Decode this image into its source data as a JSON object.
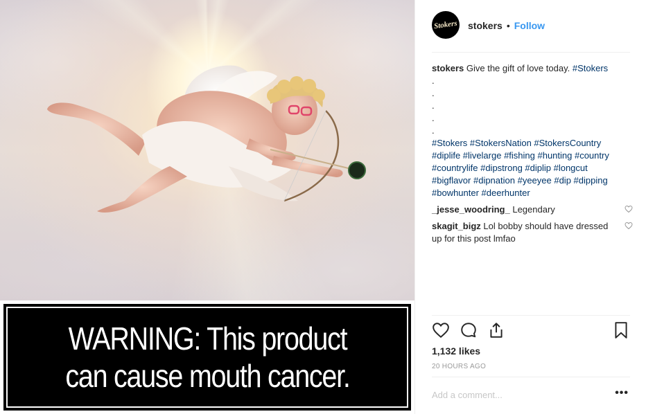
{
  "post": {
    "warning_line1": "WARNING: This product",
    "warning_line2": "can cause mouth cancer.",
    "avatar_text": "Stokers"
  },
  "header": {
    "username": "stokers",
    "separator": "•",
    "follow_label": "Follow"
  },
  "caption": {
    "username": "stokers",
    "text": "Give the gift of love today.",
    "first_tag": "#Stokers",
    "dots": [
      ".",
      ".",
      ".",
      ".",
      "."
    ],
    "hashtags_lines": [
      "#Stokers #StokersNation #StokersCountry",
      "#diplife #livelarge #fishing #hunting #country",
      "#countrylife #dipstrong #diplip #longcut",
      "#bigflavor #dipnation #yeeyee #dip #dipping",
      "#bowhunter #deerhunter"
    ]
  },
  "comments": [
    {
      "username": "_jesse_woodring_",
      "text": "Legendary"
    },
    {
      "username": "skagit_bigz",
      "text": "Lol bobby should have dressed up for this post lmfao"
    }
  ],
  "stats": {
    "likes": "1,132 likes",
    "time": "20 HOURS AGO"
  },
  "composer": {
    "placeholder": "Add a comment...",
    "more_label": "•••"
  },
  "icons": {
    "like": "heart-icon",
    "comment": "comment-icon",
    "share": "share-icon",
    "save": "bookmark-icon",
    "more": "more-options-icon"
  },
  "colors": {
    "link": "#3897f0",
    "hashtag": "#003569",
    "muted": "#999999",
    "warning_bg": "#000000"
  }
}
